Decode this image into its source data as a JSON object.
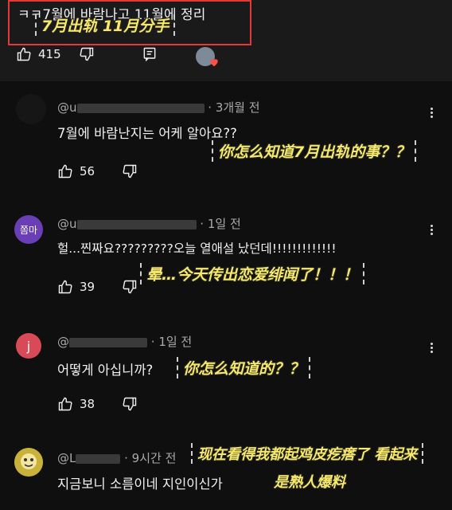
{
  "top_comment": {
    "text": "ㅋㅋ7월에 바람나고 11월에 정리",
    "subtitle": "7月出轨 11月分手",
    "like_count": "415"
  },
  "replies": [
    {
      "handle": "@u",
      "age": "· 3개월 전",
      "text": "7월에 바람난지는 어케 알아요??",
      "subtitle": "你怎么知道7月出轨的事？？",
      "like_count": "56"
    },
    {
      "avatar_label": "쫌마",
      "handle": "@u",
      "age": "· 1일 전",
      "text": "헐...찐짜요?????????오늘 열애설 났던데!!!!!!!!!!!!!",
      "subtitle": "晕…今天传出恋爱绯闻了！！！",
      "like_count": "39"
    },
    {
      "avatar_label": "j",
      "handle": "@",
      "age": "· 1일 전",
      "text": "어떻게 아십니까?",
      "subtitle": "你怎么知道的？？",
      "like_count": "38"
    },
    {
      "handle": "@L",
      "age": "· 9시간 전",
      "text": "지금보니 소름이네 지인이신가",
      "subtitle_line1": "现在看得我都起鸡皮疙瘩了 看起来",
      "subtitle_line2": "是熟人爆料"
    }
  ],
  "icons": {
    "like": "thumbs-up-icon",
    "dislike": "thumbs-down-icon",
    "reply": "reply-icon",
    "more": "more-vert-icon",
    "heart": "heart-icon"
  },
  "colors": {
    "background": "#0f0f0f",
    "subtitle": "#f6e96b",
    "highlight_border": "#e53935",
    "avatar_purple": "#6a3fb5",
    "avatar_red": "#d84a58"
  }
}
